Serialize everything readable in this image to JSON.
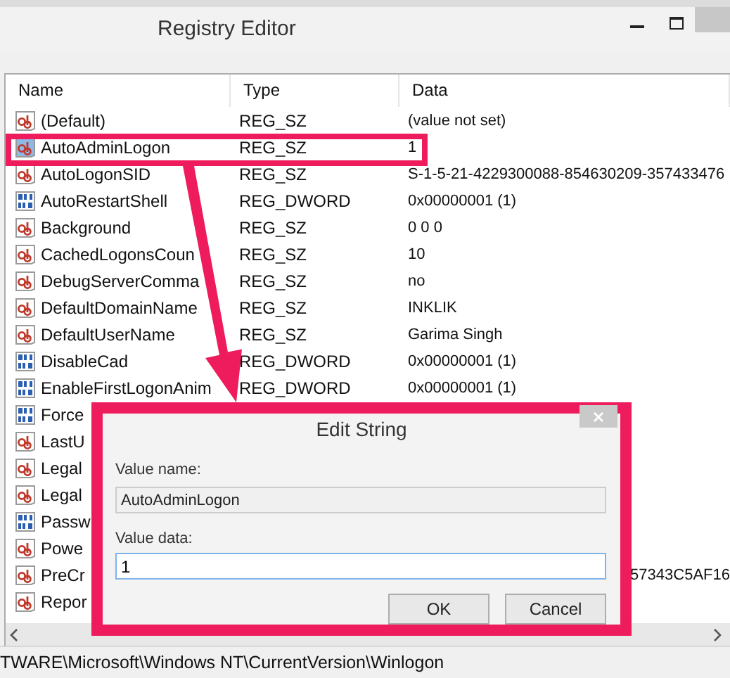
{
  "window": {
    "title": "Registry Editor"
  },
  "table": {
    "columns": [
      "Name",
      "Type",
      "Data"
    ],
    "rows": [
      {
        "kind": "sz",
        "selected": false,
        "name": "(Default)",
        "type": "REG_SZ",
        "data": "(value not set)"
      },
      {
        "kind": "sz",
        "selected": true,
        "name": "AutoAdminLogon",
        "type": "REG_SZ",
        "data": "1"
      },
      {
        "kind": "sz",
        "selected": false,
        "name": "AutoLogonSID",
        "type": "REG_SZ",
        "data": "S-1-5-21-4229300088-854630209-357433476"
      },
      {
        "kind": "dword",
        "selected": false,
        "name": "AutoRestartShell",
        "type": "REG_DWORD",
        "data": "0x00000001 (1)"
      },
      {
        "kind": "sz",
        "selected": false,
        "name": "Background",
        "type": "REG_SZ",
        "data": "0 0 0"
      },
      {
        "kind": "sz",
        "selected": false,
        "name": "CachedLogonsCoun",
        "type": "REG_SZ",
        "data": "10"
      },
      {
        "kind": "sz",
        "selected": false,
        "name": "DebugServerComma",
        "type": "REG_SZ",
        "data": "no"
      },
      {
        "kind": "sz",
        "selected": false,
        "name": "DefaultDomainName",
        "type": "REG_SZ",
        "data": "INKLIK"
      },
      {
        "kind": "sz",
        "selected": false,
        "name": "DefaultUserName",
        "type": "REG_SZ",
        "data": "Garima Singh"
      },
      {
        "kind": "dword",
        "selected": false,
        "name": "DisableCad",
        "type": "REG_DWORD",
        "data": "0x00000001 (1)"
      },
      {
        "kind": "dword",
        "selected": false,
        "name": "EnableFirstLogonAnim",
        "type": "REG_DWORD",
        "data": "0x00000001 (1)"
      },
      {
        "kind": "dword",
        "selected": false,
        "name": "Force"
      },
      {
        "kind": "sz",
        "selected": false,
        "name": "LastU"
      },
      {
        "kind": "sz",
        "selected": false,
        "name": "Legal"
      },
      {
        "kind": "sz",
        "selected": false,
        "name": "Legal"
      },
      {
        "kind": "dword",
        "selected": false,
        "name": "Passw"
      },
      {
        "kind": "sz",
        "selected": false,
        "name": "Powe"
      },
      {
        "kind": "sz",
        "selected": false,
        "name": "PreCr",
        "data": "57343C5AF16",
        "data_cut": true
      },
      {
        "kind": "sz",
        "selected": false,
        "name": "Repor"
      }
    ]
  },
  "dialog": {
    "title": "Edit String",
    "value_name_label": "Value name:",
    "value_name": "AutoAdminLogon",
    "value_data_label": "Value data:",
    "value_data": "1",
    "buttons": [
      "OK",
      "Cancel"
    ]
  },
  "status_bar": "TWARE\\Microsoft\\Windows NT\\CurrentVersion\\Winlogon"
}
